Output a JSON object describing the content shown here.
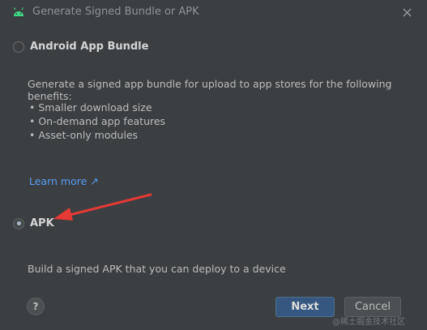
{
  "window": {
    "title": "Generate Signed Bundle or APK"
  },
  "options": {
    "bundle": {
      "label": "Android App Bundle",
      "selected": false,
      "description": "Generate a signed app bundle for upload to app stores for the following benefits:",
      "benefits": [
        "• Smaller download size",
        "• On-demand app features",
        "• Asset-only modules"
      ],
      "learn_more": "Learn more ↗"
    },
    "apk": {
      "label": "APK",
      "selected": true,
      "description": "Build a signed APK that you can deploy to a device"
    }
  },
  "footer": {
    "help_label": "?",
    "next_label": "Next",
    "cancel_label": "Cancel"
  },
  "watermark": "@稀土掘金技术社区",
  "colors": {
    "accent": "#365880",
    "link": "#589df6",
    "annotation_arrow": "#e53935"
  }
}
